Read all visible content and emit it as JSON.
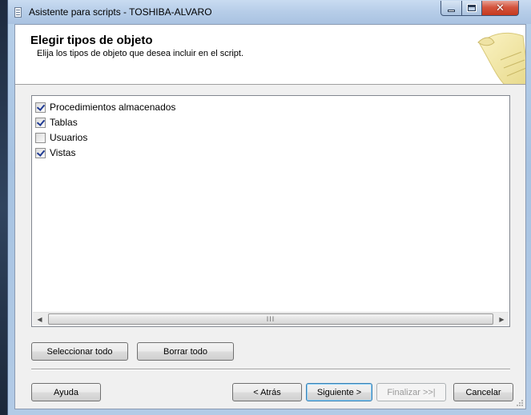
{
  "window": {
    "title": "Asistente para scripts - TOSHIBA-ALVARO",
    "controls": [
      "minimize-icon",
      "maximize-icon",
      "close-icon"
    ]
  },
  "header": {
    "title": "Elegir tipos de objeto",
    "subtitle": "Elija los tipos de objeto que desea incluir en el script.",
    "icon": "scroll-icon"
  },
  "object_types": {
    "items": [
      {
        "label": "Procedimientos almacenados",
        "checked": true
      },
      {
        "label": "Tablas",
        "checked": true
      },
      {
        "label": "Usuarios",
        "checked": false
      },
      {
        "label": "Vistas",
        "checked": true
      }
    ],
    "scrollbar_grip": "III"
  },
  "selection_buttons": {
    "select_all": "Seleccionar todo",
    "clear_all": "Borrar todo"
  },
  "footer": {
    "help": "Ayuda",
    "back": "< Atrás",
    "next": "Siguiente >",
    "finish": "Finalizar >>|",
    "cancel": "Cancelar"
  },
  "colors": {
    "title_bar": "#b6cde8",
    "close_button": "#c6391e",
    "client_bg": "#f0f0f0",
    "check_mark": "#1f3a93",
    "default_button_border": "#3c7fb1"
  }
}
